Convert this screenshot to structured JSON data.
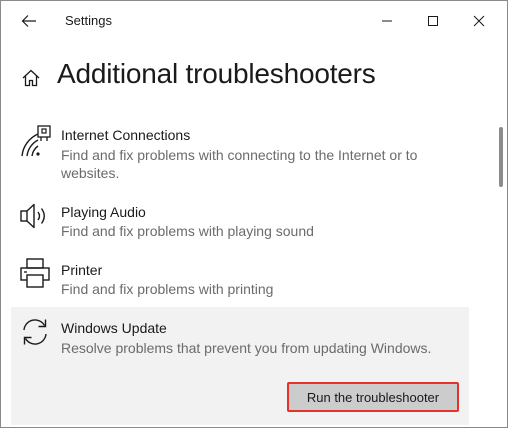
{
  "window": {
    "app_title": "Settings"
  },
  "header": {
    "title": "Additional troubleshooters"
  },
  "items": [
    {
      "title": "Internet Connections",
      "description": "Find and fix problems with connecting to the Internet or to websites.",
      "icon": "wifi-signal-icon"
    },
    {
      "title": "Playing Audio",
      "description": "Find and fix problems with playing sound",
      "icon": "speaker-icon"
    },
    {
      "title": "Printer",
      "description": "Find and fix problems with printing",
      "icon": "printer-icon"
    },
    {
      "title": "Windows Update",
      "description": "Resolve problems that prevent you from updating Windows.",
      "icon": "refresh-icon",
      "selected": true
    }
  ],
  "run_button": {
    "label": "Run the troubleshooter"
  },
  "colors": {
    "highlight_border": "#e5322d",
    "selected_background": "#f2f2f2",
    "button_background": "#cccccc",
    "description_text": "#6b6b6b"
  }
}
